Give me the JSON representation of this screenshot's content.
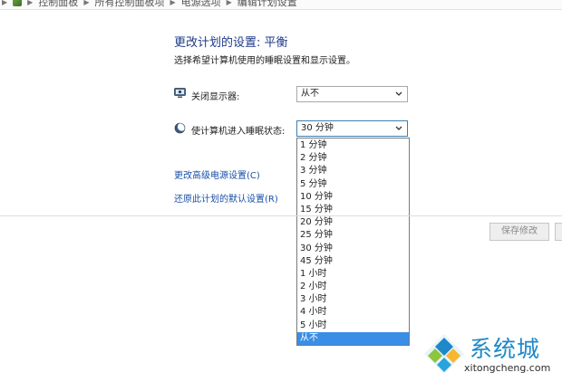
{
  "breadcrumb": {
    "items": [
      "控制面板",
      "所有控制面板项",
      "电源选项",
      "编辑计划设置"
    ]
  },
  "page": {
    "title": "更改计划的设置: 平衡",
    "subtitle": "选择希望计算机使用的睡眠设置和显示设置。"
  },
  "settings": {
    "display": {
      "label": "关闭显示器:",
      "value": "从不",
      "icon": "monitor-icon"
    },
    "sleep": {
      "label": "使计算机进入睡眠状态:",
      "value": "30 分钟",
      "icon": "moon-icon"
    }
  },
  "dropdown": {
    "options": [
      "1 分钟",
      "2 分钟",
      "3 分钟",
      "5 分钟",
      "10 分钟",
      "15 分钟",
      "20 分钟",
      "25 分钟",
      "30 分钟",
      "45 分钟",
      "1 小时",
      "2 小时",
      "3 小时",
      "4 小时",
      "5 小时",
      "从不"
    ],
    "highlighted": "从不"
  },
  "links": {
    "advanced": "更改高级电源设置(C)",
    "restore": "还原此计划的默认设置(R)"
  },
  "buttons": {
    "save": "保存修改"
  },
  "watermark": {
    "title": "系统城",
    "domain": "xitongcheng.com"
  },
  "colors": {
    "accent": "#3a8ee6",
    "link": "#1a4fa8",
    "title": "#1e3a8a"
  }
}
